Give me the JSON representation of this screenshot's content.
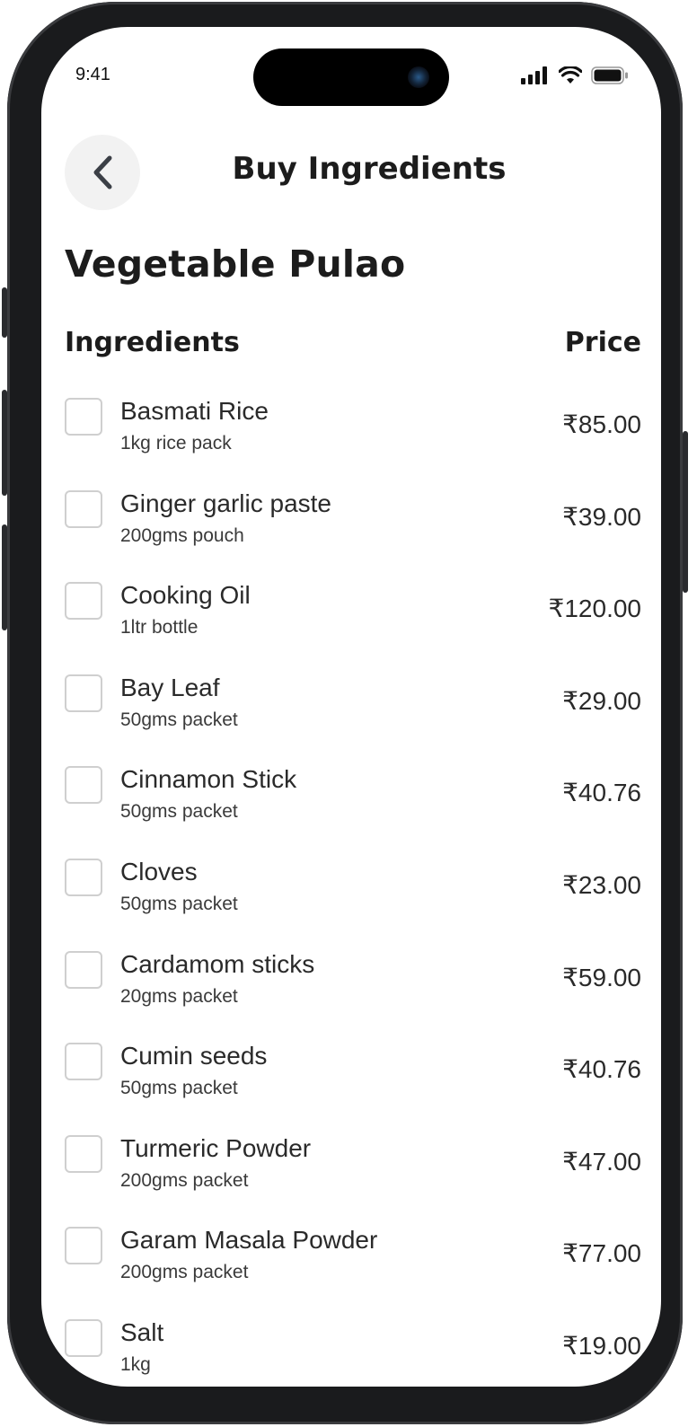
{
  "status_bar": {
    "time": "9:41",
    "icons": [
      "signal-icon",
      "wifi-icon",
      "battery-icon"
    ]
  },
  "header": {
    "back_icon": "chevron-left-icon",
    "title": "Buy Ingredients"
  },
  "recipe": {
    "title": "Vegetable Pulao"
  },
  "columns": {
    "ingredients": "Ingredients",
    "price": "Price"
  },
  "items": [
    {
      "name": "Basmati Rice",
      "desc": "1kg rice pack",
      "price": "₹85.00",
      "checked": false
    },
    {
      "name": "Ginger garlic paste",
      "desc": "200gms pouch",
      "price": "₹39.00",
      "checked": false
    },
    {
      "name": "Cooking Oil",
      "desc": "1ltr bottle",
      "price": "₹120.00",
      "checked": false
    },
    {
      "name": "Bay Leaf",
      "desc": "50gms packet",
      "price": "₹29.00",
      "checked": false
    },
    {
      "name": "Cinnamon Stick",
      "desc": "50gms packet",
      "price": "₹40.76",
      "checked": false
    },
    {
      "name": "Cloves",
      "desc": "50gms packet",
      "price": "₹23.00",
      "checked": false
    },
    {
      "name": "Cardamom sticks",
      "desc": "20gms packet",
      "price": "₹59.00",
      "checked": false
    },
    {
      "name": "Cumin seeds",
      "desc": "50gms packet",
      "price": "₹40.76",
      "checked": false
    },
    {
      "name": "Turmeric Powder",
      "desc": "200gms packet",
      "price": "₹47.00",
      "checked": false
    },
    {
      "name": "Garam Masala Powder",
      "desc": "200gms packet",
      "price": "₹77.00",
      "checked": false
    },
    {
      "name": "Salt",
      "desc": "1kg",
      "price": "₹19.00",
      "checked": false
    }
  ],
  "colors": {
    "frame": "#1a1b1d",
    "screen": "#ffffff",
    "text": "#1c1c1c",
    "checkbox_border": "#cfcfcf",
    "back_button_bg": "#f2f2f2"
  }
}
